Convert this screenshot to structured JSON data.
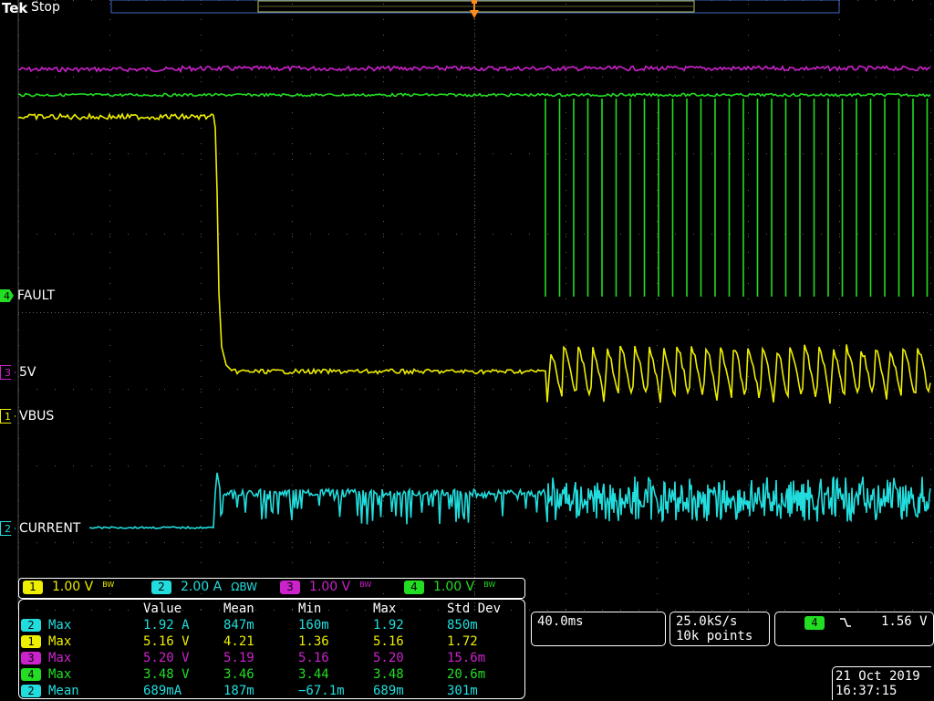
{
  "header": {
    "brand": "Tek",
    "acquisition_state": "Stop"
  },
  "channels": [
    {
      "id": "4",
      "label": "FAULT",
      "color": "#22dd22"
    },
    {
      "id": "3",
      "label": "5V",
      "color": "#cc22cc"
    },
    {
      "id": "1",
      "label": "VBUS",
      "color": "#eeee00"
    },
    {
      "id": "2",
      "label": "CURRENT",
      "color": "#22dddd"
    }
  ],
  "channel_settings": [
    {
      "id": "1",
      "scale": "1.00 V",
      "flags": "BW",
      "color": "#eeee00"
    },
    {
      "id": "2",
      "scale": "2.00 A",
      "flags": "ΩBW",
      "color": "#22dddd"
    },
    {
      "id": "3",
      "scale": "1.00 V",
      "flags": "BW",
      "color": "#cc22cc"
    },
    {
      "id": "4",
      "scale": "1.00 V",
      "flags": "BW",
      "color": "#22dd22"
    }
  ],
  "measurements": {
    "headers": [
      "Value",
      "Mean",
      "Min",
      "Max",
      "Std Dev"
    ],
    "rows": [
      {
        "ch": "2",
        "color": "#22dddd",
        "type": "Max",
        "value": "1.92 A",
        "mean": "847m",
        "min": "160m",
        "max": "1.92",
        "std": "850m"
      },
      {
        "ch": "1",
        "color": "#eeee00",
        "type": "Max",
        "value": "5.16 V",
        "mean": "4.21",
        "min": "1.36",
        "max": "5.16",
        "std": "1.72"
      },
      {
        "ch": "3",
        "color": "#cc22cc",
        "type": "Max",
        "value": "5.20 V",
        "mean": "5.19",
        "min": "5.16",
        "max": "5.20",
        "std": "15.6m"
      },
      {
        "ch": "4",
        "color": "#22dd22",
        "type": "Max",
        "value": "3.48 V",
        "mean": "3.46",
        "min": "3.44",
        "max": "3.48",
        "std": "20.6m"
      },
      {
        "ch": "2",
        "color": "#22dddd",
        "type": "Mean",
        "value": "689mA",
        "mean": "187m",
        "min": "−67.1m",
        "max": "689m",
        "std": "301m"
      }
    ]
  },
  "timebase": {
    "per_div": "40.0ms"
  },
  "sampling": {
    "rate": "25.0kS/s",
    "points": "10k points"
  },
  "trigger": {
    "channel": "4",
    "slope_icon": "falling-edge-icon",
    "level": "1.56 V",
    "color": "#22dd22"
  },
  "datetime": {
    "date": "21 Oct  2019",
    "time": "16:37:15"
  }
}
